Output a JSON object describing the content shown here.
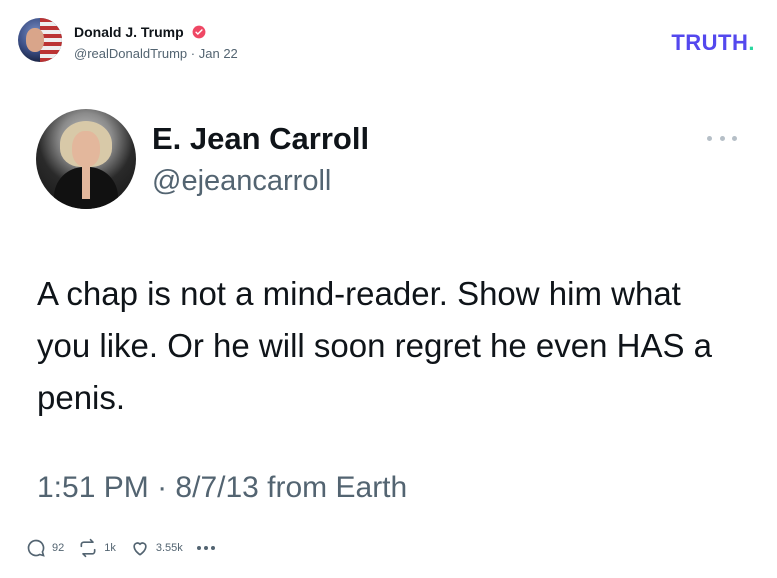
{
  "post": {
    "author_name": "Donald J. Trump",
    "author_handle": "@realDonaldTrump",
    "separator": "·",
    "date": "Jan 22",
    "brand": "TRUTH",
    "brand_dot": "."
  },
  "quoted": {
    "name": "E. Jean Carroll",
    "handle": "@ejeancarroll",
    "text": "A chap is not a mind-reader. Show him what you like. Or he will soon regret he even HAS a penis.",
    "time": "1:51 PM",
    "separator": "·",
    "date": "8/7/13 from Earth"
  },
  "actions": {
    "replies": "92",
    "retruths": "1k",
    "likes": "3.55k"
  },
  "colors": {
    "brand": "#5448ee",
    "brand_dot": "#2ad7a0",
    "verified": "#ef4764",
    "muted": "#536471"
  }
}
